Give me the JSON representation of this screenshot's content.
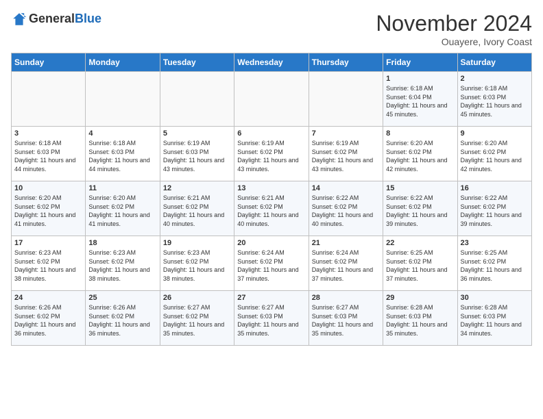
{
  "header": {
    "logo_general": "General",
    "logo_blue": "Blue",
    "month_title": "November 2024",
    "location": "Ouayere, Ivory Coast"
  },
  "days_of_week": [
    "Sunday",
    "Monday",
    "Tuesday",
    "Wednesday",
    "Thursday",
    "Friday",
    "Saturday"
  ],
  "weeks": [
    [
      {
        "day": "",
        "info": ""
      },
      {
        "day": "",
        "info": ""
      },
      {
        "day": "",
        "info": ""
      },
      {
        "day": "",
        "info": ""
      },
      {
        "day": "",
        "info": ""
      },
      {
        "day": "1",
        "info": "Sunrise: 6:18 AM\nSunset: 6:04 PM\nDaylight: 11 hours and 45 minutes."
      },
      {
        "day": "2",
        "info": "Sunrise: 6:18 AM\nSunset: 6:03 PM\nDaylight: 11 hours and 45 minutes."
      }
    ],
    [
      {
        "day": "3",
        "info": "Sunrise: 6:18 AM\nSunset: 6:03 PM\nDaylight: 11 hours and 44 minutes."
      },
      {
        "day": "4",
        "info": "Sunrise: 6:18 AM\nSunset: 6:03 PM\nDaylight: 11 hours and 44 minutes."
      },
      {
        "day": "5",
        "info": "Sunrise: 6:19 AM\nSunset: 6:03 PM\nDaylight: 11 hours and 43 minutes."
      },
      {
        "day": "6",
        "info": "Sunrise: 6:19 AM\nSunset: 6:02 PM\nDaylight: 11 hours and 43 minutes."
      },
      {
        "day": "7",
        "info": "Sunrise: 6:19 AM\nSunset: 6:02 PM\nDaylight: 11 hours and 43 minutes."
      },
      {
        "day": "8",
        "info": "Sunrise: 6:20 AM\nSunset: 6:02 PM\nDaylight: 11 hours and 42 minutes."
      },
      {
        "day": "9",
        "info": "Sunrise: 6:20 AM\nSunset: 6:02 PM\nDaylight: 11 hours and 42 minutes."
      }
    ],
    [
      {
        "day": "10",
        "info": "Sunrise: 6:20 AM\nSunset: 6:02 PM\nDaylight: 11 hours and 41 minutes."
      },
      {
        "day": "11",
        "info": "Sunrise: 6:20 AM\nSunset: 6:02 PM\nDaylight: 11 hours and 41 minutes."
      },
      {
        "day": "12",
        "info": "Sunrise: 6:21 AM\nSunset: 6:02 PM\nDaylight: 11 hours and 40 minutes."
      },
      {
        "day": "13",
        "info": "Sunrise: 6:21 AM\nSunset: 6:02 PM\nDaylight: 11 hours and 40 minutes."
      },
      {
        "day": "14",
        "info": "Sunrise: 6:22 AM\nSunset: 6:02 PM\nDaylight: 11 hours and 40 minutes."
      },
      {
        "day": "15",
        "info": "Sunrise: 6:22 AM\nSunset: 6:02 PM\nDaylight: 11 hours and 39 minutes."
      },
      {
        "day": "16",
        "info": "Sunrise: 6:22 AM\nSunset: 6:02 PM\nDaylight: 11 hours and 39 minutes."
      }
    ],
    [
      {
        "day": "17",
        "info": "Sunrise: 6:23 AM\nSunset: 6:02 PM\nDaylight: 11 hours and 38 minutes."
      },
      {
        "day": "18",
        "info": "Sunrise: 6:23 AM\nSunset: 6:02 PM\nDaylight: 11 hours and 38 minutes."
      },
      {
        "day": "19",
        "info": "Sunrise: 6:23 AM\nSunset: 6:02 PM\nDaylight: 11 hours and 38 minutes."
      },
      {
        "day": "20",
        "info": "Sunrise: 6:24 AM\nSunset: 6:02 PM\nDaylight: 11 hours and 37 minutes."
      },
      {
        "day": "21",
        "info": "Sunrise: 6:24 AM\nSunset: 6:02 PM\nDaylight: 11 hours and 37 minutes."
      },
      {
        "day": "22",
        "info": "Sunrise: 6:25 AM\nSunset: 6:02 PM\nDaylight: 11 hours and 37 minutes."
      },
      {
        "day": "23",
        "info": "Sunrise: 6:25 AM\nSunset: 6:02 PM\nDaylight: 11 hours and 36 minutes."
      }
    ],
    [
      {
        "day": "24",
        "info": "Sunrise: 6:26 AM\nSunset: 6:02 PM\nDaylight: 11 hours and 36 minutes."
      },
      {
        "day": "25",
        "info": "Sunrise: 6:26 AM\nSunset: 6:02 PM\nDaylight: 11 hours and 36 minutes."
      },
      {
        "day": "26",
        "info": "Sunrise: 6:27 AM\nSunset: 6:02 PM\nDaylight: 11 hours and 35 minutes."
      },
      {
        "day": "27",
        "info": "Sunrise: 6:27 AM\nSunset: 6:03 PM\nDaylight: 11 hours and 35 minutes."
      },
      {
        "day": "28",
        "info": "Sunrise: 6:27 AM\nSunset: 6:03 PM\nDaylight: 11 hours and 35 minutes."
      },
      {
        "day": "29",
        "info": "Sunrise: 6:28 AM\nSunset: 6:03 PM\nDaylight: 11 hours and 35 minutes."
      },
      {
        "day": "30",
        "info": "Sunrise: 6:28 AM\nSunset: 6:03 PM\nDaylight: 11 hours and 34 minutes."
      }
    ]
  ]
}
